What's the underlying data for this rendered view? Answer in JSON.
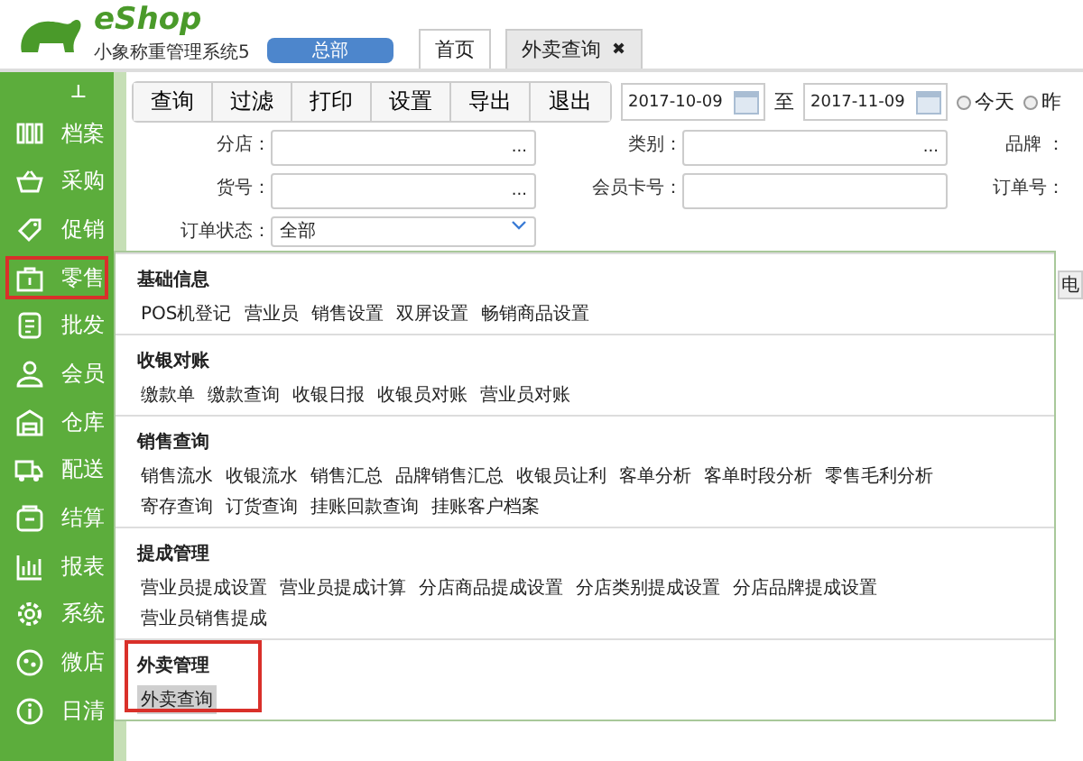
{
  "header": {
    "brand": "eShop",
    "subtitle": "小象称重管理系统5",
    "branch_button": "总部",
    "tabs": [
      {
        "label": "首页",
        "selected": false,
        "closable": false
      },
      {
        "label": "外卖查询",
        "selected": true,
        "closable": true,
        "close_label": "✖"
      }
    ]
  },
  "sidebar": {
    "pin_label": "⊥",
    "items": [
      {
        "label": "档案",
        "highlighted": false
      },
      {
        "label": "采购",
        "highlighted": false
      },
      {
        "label": "促销",
        "highlighted": false
      },
      {
        "label": "零售",
        "highlighted": true
      },
      {
        "label": "批发",
        "highlighted": false
      },
      {
        "label": "会员",
        "highlighted": false
      },
      {
        "label": "仓库",
        "highlighted": false
      },
      {
        "label": "配送",
        "highlighted": false
      },
      {
        "label": "结算",
        "highlighted": false
      },
      {
        "label": "报表",
        "highlighted": false
      },
      {
        "label": "系统",
        "highlighted": false
      },
      {
        "label": "微店",
        "highlighted": false
      },
      {
        "label": "日清",
        "highlighted": false
      }
    ]
  },
  "toolbar": {
    "buttons": [
      "查询",
      "过滤",
      "打印",
      "设置",
      "导出",
      "退出"
    ],
    "date_from": "2017-10-09",
    "date_separator": "至",
    "date_to": "2017-11-09",
    "radios": [
      {
        "label": "今天",
        "selected": false
      },
      {
        "label": "昨",
        "selected": false
      }
    ]
  },
  "filters": [
    [
      {
        "label": "分店：",
        "kind": "browse",
        "browse_label": "..."
      },
      {
        "label": "类别：",
        "kind": "browse",
        "browse_label": "..."
      },
      {
        "label": "品牌 ：",
        "kind": "cut"
      }
    ],
    [
      {
        "label": "货号：",
        "kind": "browse",
        "browse_label": "..."
      },
      {
        "label": "会员卡号：",
        "kind": "text"
      },
      {
        "label": "订单号：",
        "kind": "cut"
      }
    ],
    [
      {
        "label": "订单状态：",
        "kind": "select",
        "value": "全部"
      }
    ]
  ],
  "table": {
    "column_1": "电"
  },
  "menu": {
    "sections": [
      {
        "title": "基础信息",
        "highlighted": false,
        "items": [
          {
            "label": "POS机登记",
            "selected": false
          },
          {
            "label": "营业员",
            "selected": false
          },
          {
            "label": "销售设置",
            "selected": false
          },
          {
            "label": "双屏设置",
            "selected": false
          },
          {
            "label": "畅销商品设置",
            "selected": false
          }
        ]
      },
      {
        "title": "收银对账",
        "highlighted": false,
        "items": [
          {
            "label": "缴款单",
            "selected": false
          },
          {
            "label": "缴款查询",
            "selected": false
          },
          {
            "label": "收银日报",
            "selected": false
          },
          {
            "label": "收银员对账",
            "selected": false
          },
          {
            "label": "营业员对账",
            "selected": false
          }
        ]
      },
      {
        "title": "销售查询",
        "highlighted": false,
        "items": [
          {
            "label": "销售流水",
            "selected": false
          },
          {
            "label": "收银流水",
            "selected": false
          },
          {
            "label": "销售汇总",
            "selected": false
          },
          {
            "label": "品牌销售汇总",
            "selected": false
          },
          {
            "label": "收银员让利",
            "selected": false
          },
          {
            "label": "客单分析",
            "selected": false
          },
          {
            "label": "客单时段分析",
            "selected": false
          },
          {
            "label": "零售毛利分析",
            "selected": false
          },
          {
            "label": "寄存查询",
            "selected": false
          },
          {
            "label": "订货查询",
            "selected": false
          },
          {
            "label": "挂账回款查询",
            "selected": false
          },
          {
            "label": "挂账客户档案",
            "selected": false
          }
        ]
      },
      {
        "title": "提成管理",
        "highlighted": false,
        "items": [
          {
            "label": "营业员提成设置",
            "selected": false
          },
          {
            "label": "营业员提成计算",
            "selected": false
          },
          {
            "label": "分店商品提成设置",
            "selected": false
          },
          {
            "label": "分店类别提成设置",
            "selected": false
          },
          {
            "label": "分店品牌提成设置",
            "selected": false
          },
          {
            "label": "营业员销售提成",
            "selected": false
          }
        ]
      },
      {
        "title": "外卖管理",
        "highlighted": true,
        "items": [
          {
            "label": "外卖查询",
            "selected": true
          }
        ]
      }
    ]
  }
}
